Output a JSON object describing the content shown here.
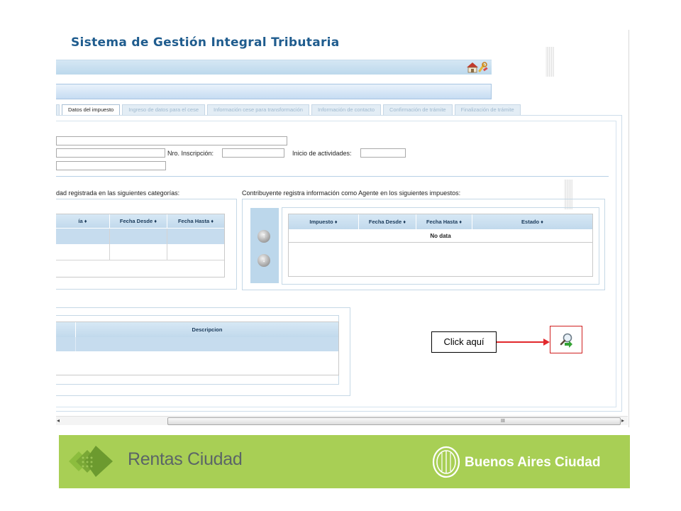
{
  "app": {
    "title": "Sistema de Gestión Integral Tributaria"
  },
  "toolbar": {
    "icons": [
      "home-icon",
      "tools-icon"
    ]
  },
  "tabs": [
    {
      "label": "",
      "active": false
    },
    {
      "label": "Datos del impuesto",
      "active": true
    },
    {
      "label": "Ingreso de datos para el cese",
      "active": false
    },
    {
      "label": "Información cese para transformación",
      "active": false
    },
    {
      "label": "Información de contacto",
      "active": false
    },
    {
      "label": "Confirmación de trámite",
      "active": false
    },
    {
      "label": "Finalización de trámite",
      "active": false
    }
  ],
  "form": {
    "nro_inscripcion_label": "Nro. Inscripción:",
    "inicio_actividades_label": "Inicio de actividades:"
  },
  "categories": {
    "caption": "dad registrada en las siguientes categorías:",
    "columns": [
      "ía",
      "Fecha Desde",
      "Fecha Hasta"
    ]
  },
  "agent": {
    "caption": "Contribuyente registra información como Agente en los siguientes impuestos:",
    "columns": [
      "Impuesto",
      "Fecha Desde",
      "Fecha Hasta",
      "Estado"
    ],
    "empty_text": "No data"
  },
  "descripcion_table": {
    "columns": [
      "",
      "Descripcion"
    ]
  },
  "scroll": {
    "left_arrow": "◂",
    "right_arrow": "▸",
    "grip": "III"
  },
  "callout": {
    "text": "Click aquí"
  },
  "footer": {
    "brand": "Rentas Ciudad",
    "city": "Buenos Aires Ciudad"
  },
  "colors": {
    "title": "#1f5c8e",
    "footer_bg": "#a8cf55",
    "callout_red": "#e2282c",
    "grid_header": "#c6dcee"
  }
}
